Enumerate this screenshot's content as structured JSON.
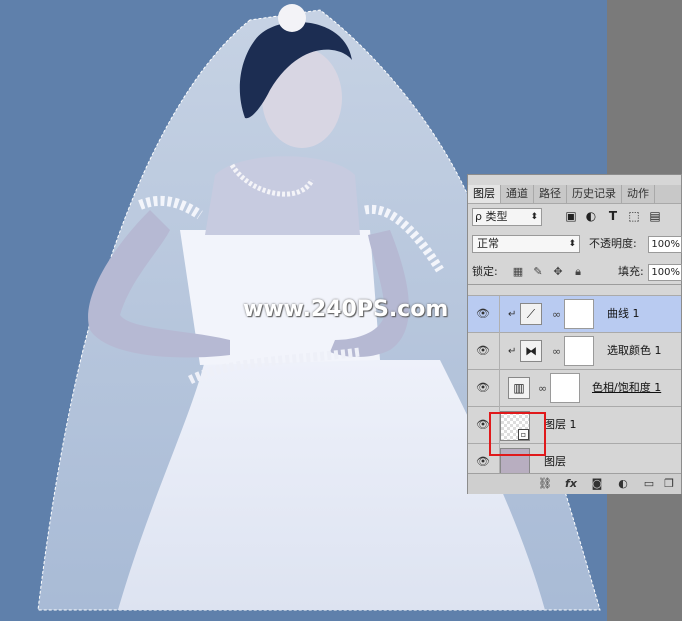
{
  "watermark": "www.240PS.com",
  "panel": {
    "tabs": [
      {
        "label": "图层"
      },
      {
        "label": "通道"
      },
      {
        "label": "路径"
      },
      {
        "label": "历史记录"
      },
      {
        "label": "动作"
      }
    ],
    "filter": {
      "label": "ρ 类型",
      "icons": [
        "image-filter-icon",
        "adjustment-filter-icon",
        "type-filter-icon",
        "shape-filter-icon",
        "smart-object-filter-icon"
      ]
    },
    "blend_mode": "正常",
    "opacity_label": "不透明度:",
    "opacity_value": "100%",
    "lock_label": "锁定:",
    "fill_label": "填充:",
    "fill_value": "100%",
    "layers": [
      {
        "name": "曲线 1",
        "type": "curves-adjustment",
        "clipped": true,
        "selected": true,
        "visible": true
      },
      {
        "name": "选取颜色 1",
        "type": "selective-color-adjustment",
        "clipped": true,
        "selected": false,
        "visible": true
      },
      {
        "name": "色相/饱和度 1",
        "type": "hue-saturation-adjustment",
        "clipped": false,
        "selected": false,
        "visible": true
      },
      {
        "name": "图层 1",
        "type": "smart-object",
        "clipped": false,
        "selected": false,
        "visible": true,
        "highlighted": true
      },
      {
        "name": "图层",
        "type": "pixel",
        "clipped": false,
        "selected": false,
        "visible": true
      }
    ],
    "bottom_icons": [
      "link-icon",
      "fx-icon",
      "add-mask-icon",
      "adjustment-icon",
      "new-group-icon",
      "new-layer-icon",
      "delete-icon"
    ],
    "fx_label": "fx"
  }
}
